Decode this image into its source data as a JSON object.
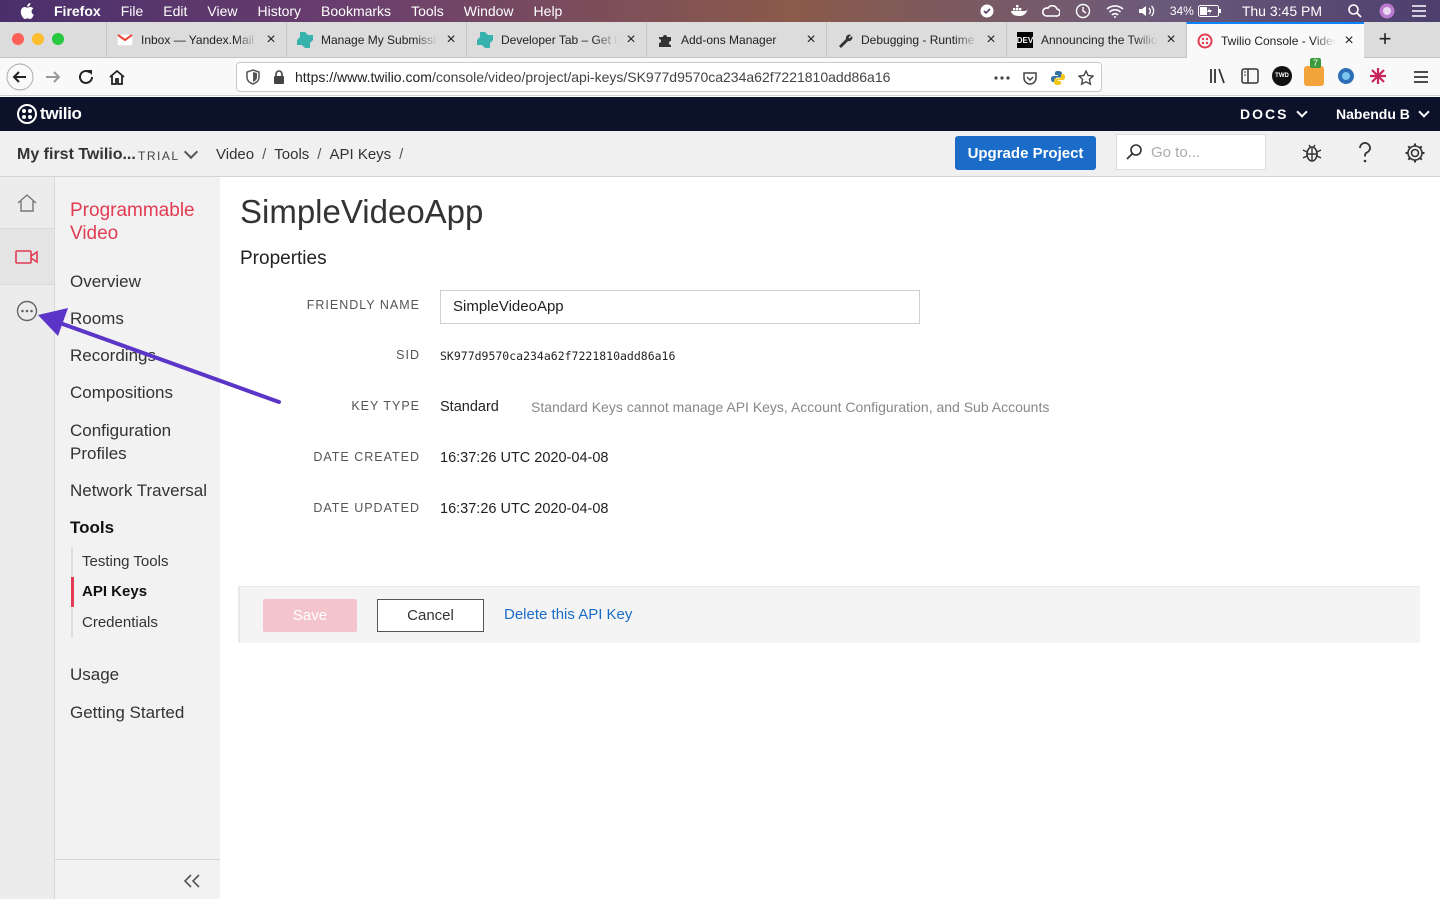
{
  "menubar": {
    "app": "Firefox",
    "items": [
      "File",
      "Edit",
      "View",
      "History",
      "Bookmarks",
      "Tools",
      "Window",
      "Help"
    ],
    "battery": "34%",
    "clock": "Thu 3:45 PM"
  },
  "tabs": [
    {
      "title": "Inbox — Yandex.Mail",
      "icon": "gmail-icon"
    },
    {
      "title": "Manage My Submissions",
      "icon": "hashnode-icon"
    },
    {
      "title": "Developer Tab – Get the",
      "icon": "hashnode-icon"
    },
    {
      "title": "Add-ons Manager",
      "icon": "puzzle-icon"
    },
    {
      "title": "Debugging - Runtime /",
      "icon": "wrench-icon"
    },
    {
      "title": "Announcing the Twilio",
      "icon": "dev-icon"
    },
    {
      "title": "Twilio Console - Video",
      "icon": "twilio-icon",
      "active": true
    }
  ],
  "urlbar": {
    "host": "https://www.twilio.com",
    "path": "/console/video/project/api-keys/SK977d9570ca234a62f7221810add86a16"
  },
  "toolbar": {
    "ext_badge": "7"
  },
  "twilio_header": {
    "logo": "twilio",
    "docs": "DOCS",
    "user": "Nabendu B"
  },
  "project_bar": {
    "project_name": "My first Twilio...",
    "badge": "TRIAL",
    "breadcrumbs": [
      "Video",
      "Tools",
      "API Keys"
    ],
    "upgrade": "Upgrade Project",
    "search_placeholder": "Go to..."
  },
  "sidenav": {
    "title": "Programmable Video",
    "items": {
      "overview": "Overview",
      "rooms": "Rooms",
      "recordings": "Recordings",
      "compositions": "Compositions",
      "config": "Configuration Profiles",
      "network": "Network Traversal",
      "tools": "Tools",
      "usage": "Usage",
      "getting_started": "Getting Started"
    },
    "tools_sub": {
      "testing": "Testing Tools",
      "api_keys": "API Keys",
      "credentials": "Credentials"
    }
  },
  "main": {
    "title": "SimpleVideoApp",
    "section": "Properties",
    "friendly_name_label": "FRIENDLY NAME",
    "friendly_name_value": "SimpleVideoApp",
    "sid_label": "SID",
    "sid_value": "SK977d9570ca234a62f7221810add86a16",
    "key_type_label": "KEY TYPE",
    "key_type_value": "Standard",
    "key_type_desc": "Standard Keys cannot manage API Keys, Account Configuration, and Sub Accounts",
    "date_created_label": "DATE CREATED",
    "date_created_value": "16:37:26 UTC 2020-04-08",
    "date_updated_label": "DATE UPDATED",
    "date_updated_value": "16:37:26 UTC 2020-04-08"
  },
  "actions": {
    "save": "Save",
    "cancel": "Cancel",
    "delete": "Delete this API Key"
  },
  "colors": {
    "accent": "#e23c53",
    "primary": "#1a6cc8",
    "header_bg": "#0d122b",
    "annotation": "#5b35c8"
  }
}
